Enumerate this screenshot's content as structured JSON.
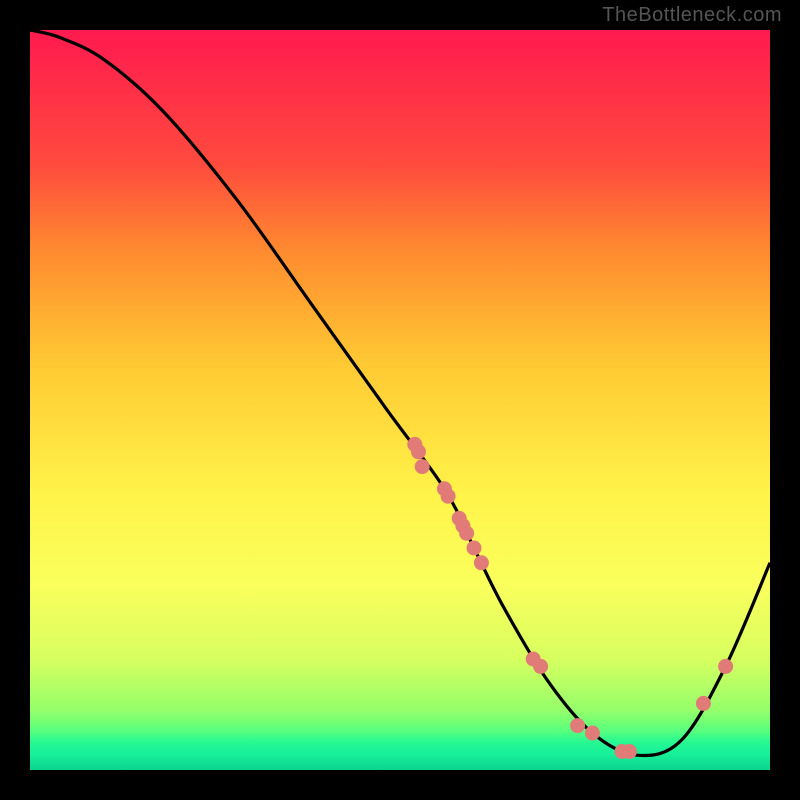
{
  "watermark": "TheBottleneck.com",
  "chart_data": {
    "type": "line",
    "title": "",
    "xlabel": "",
    "ylabel": "",
    "xlim": [
      0,
      100
    ],
    "ylim": [
      0,
      100
    ],
    "series": [
      {
        "name": "bottleneck-curve",
        "x": [
          0,
          4,
          10,
          18,
          28,
          38,
          48,
          56,
          60,
          64,
          70,
          76,
          82,
          88,
          94,
          100
        ],
        "values": [
          100,
          99,
          96,
          89,
          77,
          63,
          49,
          38,
          30,
          22,
          12,
          5,
          2,
          4,
          14,
          28
        ]
      }
    ],
    "scatter_overlay": {
      "name": "highlight-points",
      "x": [
        52,
        52.5,
        53,
        56,
        56.5,
        58,
        58.5,
        59,
        60,
        61,
        68,
        69,
        74,
        76,
        80,
        81,
        91,
        94
      ],
      "values": [
        44,
        43,
        41,
        38,
        37,
        34,
        33,
        32,
        30,
        28,
        15,
        14,
        6,
        5,
        2.5,
        2.5,
        9,
        14
      ]
    },
    "annotations": []
  }
}
